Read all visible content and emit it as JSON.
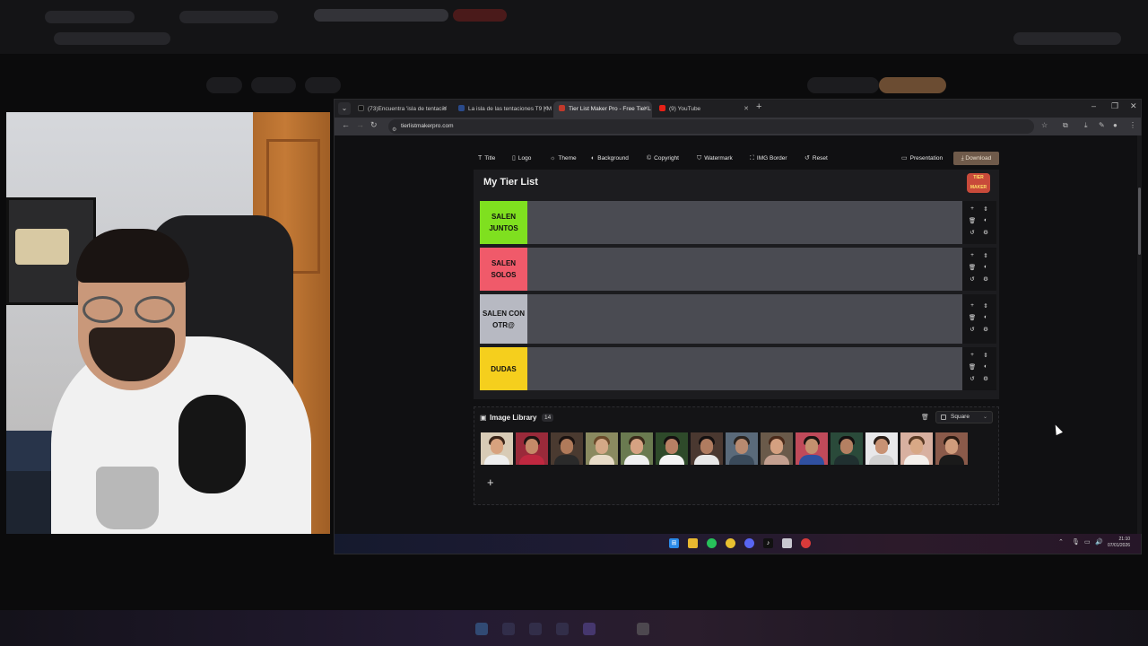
{
  "browser": {
    "tabs": [
      {
        "label": "(73)Encuentra 'isla de tentacio",
        "favicon_color": "#111111"
      },
      {
        "label": "La isla de las tentaciones T9 | M",
        "favicon_color": "#2a4a8a"
      },
      {
        "label": "Tier List Maker Pro - Free Tier L",
        "favicon_color": "#c0392b"
      },
      {
        "label": "(9) YouTube",
        "favicon_color": "#e62117"
      }
    ],
    "url": "tierlistmakerpro.com"
  },
  "toolbar": {
    "title": "Title",
    "logo": "Logo",
    "theme": "Theme",
    "background": "Background",
    "copyright": "Copyright",
    "watermark": "Watermark",
    "img_border": "IMG Border",
    "reset": "Reset",
    "presentation": "Presentation",
    "download": "Download"
  },
  "tierlist": {
    "title": "My Tier List",
    "tiers": [
      {
        "label": "SALEN JUNTOS",
        "color": "#7fe01f"
      },
      {
        "label": "SALEN SOLOS",
        "color": "#f05a6a"
      },
      {
        "label": "SALEN CON OTR@",
        "color": "#b7b9c2"
      },
      {
        "label": "DUDAS",
        "color": "#f5cf1d"
      }
    ]
  },
  "library": {
    "title": "Image Library",
    "count": "14",
    "shape": "Square",
    "add": "+"
  },
  "taskbar": {
    "time": "21:10",
    "date": "07/01/2026"
  }
}
